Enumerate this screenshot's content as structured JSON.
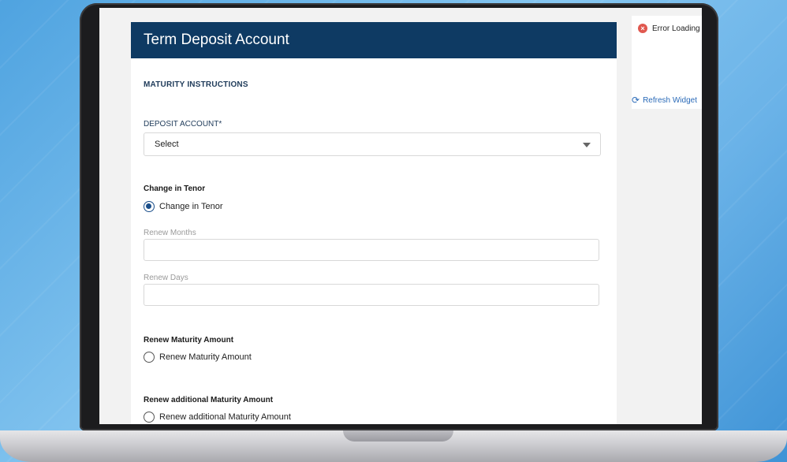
{
  "form": {
    "title": "Term Deposit Account",
    "section_title": "MATURITY INSTRUCTIONS",
    "deposit_account": {
      "label": "DEPOSIT ACCOUNT*",
      "selected": "Select"
    },
    "change_in_tenor": {
      "group_title": "Change in Tenor",
      "option_label": "Change in Tenor",
      "renew_months_label": "Renew Months",
      "renew_days_label": "Renew Days"
    },
    "renew_maturity": {
      "group_title": "Renew Maturity Amount",
      "option_label": "Renew Maturity Amount"
    },
    "renew_additional": {
      "group_title": "Renew additional Maturity Amount",
      "option_label": "Renew additional Maturity Amount"
    }
  },
  "widget": {
    "error_text": "Error Loading",
    "refresh_label": "Refresh Widget"
  },
  "colors": {
    "header_bg": "#0e3a63",
    "radio_checked": "#1a4e8a",
    "link": "#2a6ab8",
    "error": "#e0584f"
  },
  "icons": {
    "error": "error-circle-icon",
    "refresh": "refresh-icon",
    "dropdown": "chevron-down-icon"
  }
}
